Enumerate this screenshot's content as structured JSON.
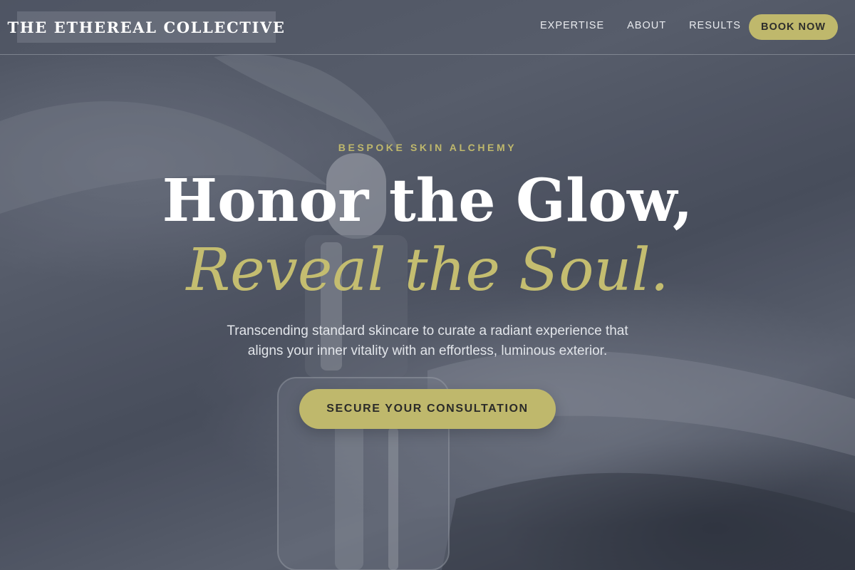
{
  "site": {
    "logo_text": "THE ETHEREAL COLLECTIVE"
  },
  "nav": {
    "links": [
      "EXPERTISE",
      "ABOUT",
      "RESULTS"
    ],
    "book_label": "BOOK NOW"
  },
  "hero": {
    "eyebrow": "BESPOKE SKIN ALCHEMY",
    "headline": "Honor the Glow,",
    "headline_accent": "Reveal the Soul.",
    "subtitle_line1": "Transcending standard skincare to curate a radiant experience that",
    "subtitle_line2": "aligns your inner vitality with an effortless, luminous exterior.",
    "cta_label": "SECURE YOUR CONSULTATION",
    "background_image": "serum-dropper-bottle-photo"
  },
  "colors": {
    "accent": "#bfb86c",
    "overlay": "#4a505c",
    "text_light": "#ffffff"
  }
}
